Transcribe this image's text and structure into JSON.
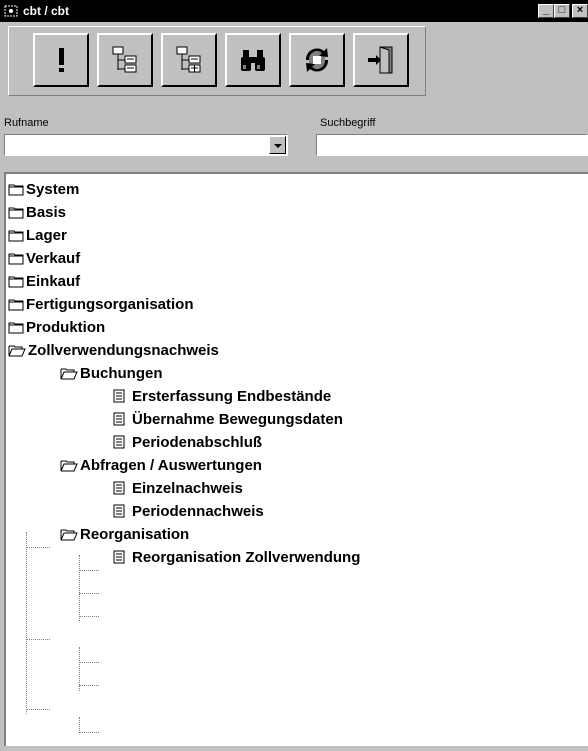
{
  "window": {
    "title": "cbt / cbt"
  },
  "title_buttons": [
    {
      "name": "minimize",
      "glyph": "_"
    },
    {
      "name": "maximize",
      "glyph": "□"
    },
    {
      "name": "close",
      "glyph": "×"
    }
  ],
  "toolbar": [
    {
      "name": "execute",
      "icon": "exclamation-icon"
    },
    {
      "name": "expand-tree",
      "icon": "tree-expand-icon"
    },
    {
      "name": "collapse-tree",
      "icon": "tree-collapse-icon"
    },
    {
      "name": "search",
      "icon": "binoculars-icon"
    },
    {
      "name": "refresh",
      "icon": "refresh-icon"
    },
    {
      "name": "exit",
      "icon": "exit-door-icon"
    }
  ],
  "fields": {
    "rufname_label": "Rufname",
    "rufname_value": "",
    "suchbegriff_label": "Suchbegriff",
    "suchbegriff_value": ""
  },
  "tree": [
    {
      "label": "System",
      "type": "folder",
      "level": 0
    },
    {
      "label": "Basis",
      "type": "folder",
      "level": 0
    },
    {
      "label": "Lager",
      "type": "folder",
      "level": 0
    },
    {
      "label": "Verkauf",
      "type": "folder",
      "level": 0
    },
    {
      "label": "Einkauf",
      "type": "folder",
      "level": 0
    },
    {
      "label": "Fertigungsorganisation",
      "type": "folder",
      "level": 0
    },
    {
      "label": "Produktion",
      "type": "folder",
      "level": 0
    },
    {
      "label": "Zollverwendungsnachweis",
      "type": "folder-open",
      "level": 0
    },
    {
      "label": "Buchungen",
      "type": "folder-open",
      "level": 1
    },
    {
      "label": "Ersterfassung Endbestände",
      "type": "doc",
      "level": 2
    },
    {
      "label": "Übernahme Bewegungsdaten",
      "type": "doc",
      "level": 2
    },
    {
      "label": "Periodenabschluß",
      "type": "doc",
      "level": 2
    },
    {
      "label": "Abfragen / Auswertungen",
      "type": "folder-open",
      "level": 1
    },
    {
      "label": "Einzelnachweis",
      "type": "doc",
      "level": 2
    },
    {
      "label": "Periodennachweis",
      "type": "doc",
      "level": 2
    },
    {
      "label": "Reorganisation",
      "type": "folder-open",
      "level": 1
    },
    {
      "label": "Reorganisation Zollverwendung",
      "type": "doc",
      "level": 2
    }
  ]
}
